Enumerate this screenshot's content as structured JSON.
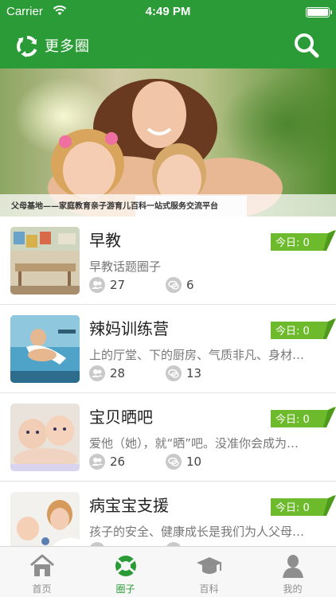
{
  "status_bar": {
    "carrier": "Carrier",
    "time": "4:49 PM"
  },
  "nav": {
    "title": "更多圈",
    "refresh_icon": "refresh-icon",
    "search_icon": "search-icon"
  },
  "banner": {
    "caption": "父母基地——家庭教育亲子游育儿百科一站式服务交流平台"
  },
  "circles": [
    {
      "title": "早教",
      "description": "早教话题圈子",
      "members": "27",
      "posts": "6",
      "today_label": "今日:",
      "today_count": "0"
    },
    {
      "title": "辣妈训练营",
      "description": "上的厅堂、下的厨房、气质非凡、身材…",
      "members": "28",
      "posts": "13",
      "today_label": "今日:",
      "today_count": "0"
    },
    {
      "title": "宝贝晒吧",
      "description": "爱他（她），就“晒”吧。没准你会成为…",
      "members": "26",
      "posts": "10",
      "today_label": "今日:",
      "today_count": "0"
    },
    {
      "title": "病宝宝支援",
      "description": "孩子的安全、健康成长是我们为人父母…",
      "members": "",
      "posts": "",
      "today_label": "今日:",
      "today_count": "0"
    }
  ],
  "tabbar": {
    "tabs": [
      {
        "label": "首页",
        "icon": "home-icon",
        "active": false
      },
      {
        "label": "圈子",
        "icon": "lifebuoy-icon",
        "active": true
      },
      {
        "label": "百科",
        "icon": "graduation-cap-icon",
        "active": false
      },
      {
        "label": "我的",
        "icon": "user-icon",
        "active": false
      }
    ]
  },
  "colors": {
    "brand_green": "#2b9b37",
    "badge_green": "#6dbb2c",
    "tab_inactive": "#8e8e8e"
  }
}
